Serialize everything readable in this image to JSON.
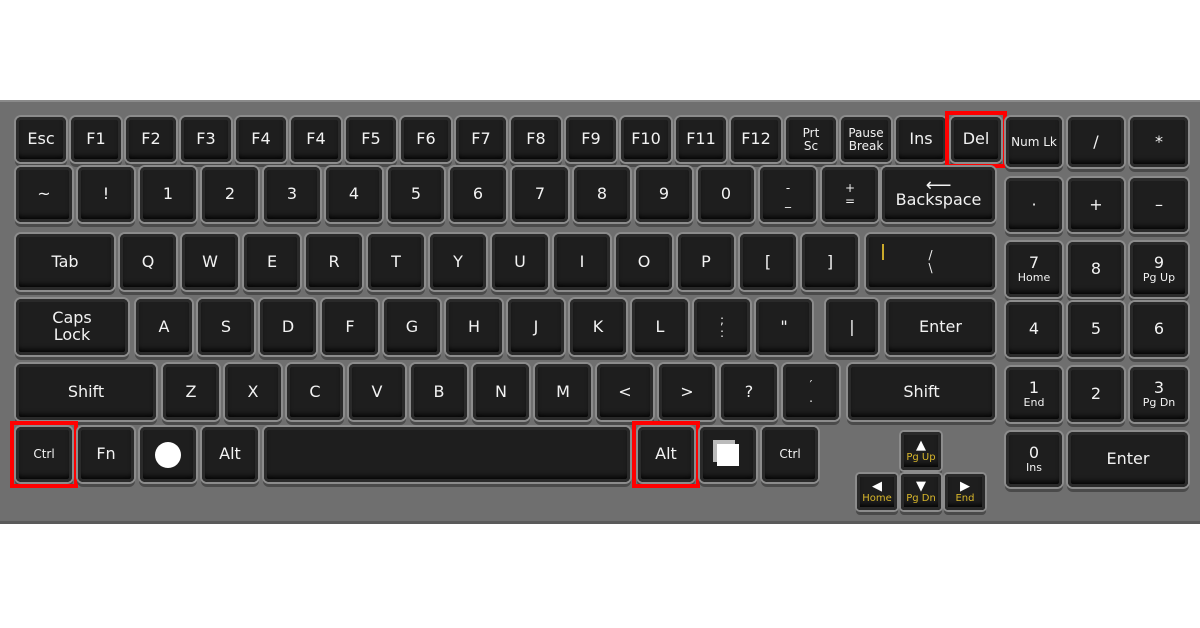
{
  "keyboard": {
    "rows": [
      [
        {
          "label": "Esc"
        },
        {
          "label": "F1"
        },
        {
          "label": "F2"
        },
        {
          "label": "F3"
        },
        {
          "label": "F4"
        },
        {
          "label": "F4"
        },
        {
          "label": "F5"
        },
        {
          "label": "F6"
        },
        {
          "label": "F7"
        },
        {
          "label": "F8"
        },
        {
          "label": "F9"
        },
        {
          "label": "F10"
        },
        {
          "label": "F11"
        },
        {
          "label": "F12"
        },
        {
          "label": "Prt\nSc"
        },
        {
          "label": "Pause\nBreak"
        },
        {
          "label": "Ins"
        },
        {
          "label": "Del",
          "highlighted": true
        },
        {
          "label": "Num Lk"
        },
        {
          "label": "/"
        },
        {
          "label": "*"
        }
      ],
      [
        {
          "label": "~"
        },
        {
          "label": "!"
        },
        {
          "label": "1"
        },
        {
          "label": "2"
        },
        {
          "label": "3"
        },
        {
          "label": "4"
        },
        {
          "label": "5"
        },
        {
          "label": "6"
        },
        {
          "label": "7"
        },
        {
          "label": "8"
        },
        {
          "label": "9"
        },
        {
          "label": "0"
        },
        {
          "label": "-\n_"
        },
        {
          "label": "+\n="
        },
        {
          "label": "Backspace",
          "icon": "left-arrow-icon"
        },
        {
          "label": "·"
        },
        {
          "label": "+"
        },
        {
          "label": "–"
        }
      ],
      [
        {
          "label": "Tab"
        },
        {
          "label": "Q"
        },
        {
          "label": "W"
        },
        {
          "label": "E"
        },
        {
          "label": "R"
        },
        {
          "label": "T"
        },
        {
          "label": "Y"
        },
        {
          "label": "U"
        },
        {
          "label": "I"
        },
        {
          "label": "O"
        },
        {
          "label": "P"
        },
        {
          "label": "["
        },
        {
          "label": "]"
        },
        {
          "label": "/\n\\",
          "accent": "|"
        },
        {
          "label": "7",
          "sub": "Home"
        },
        {
          "label": "8"
        },
        {
          "label": "9",
          "sub": "Pg Up"
        }
      ],
      [
        {
          "label": "Caps\nLock"
        },
        {
          "label": "A"
        },
        {
          "label": "S"
        },
        {
          "label": "D"
        },
        {
          "label": "F"
        },
        {
          "label": "G"
        },
        {
          "label": "H"
        },
        {
          "label": "J"
        },
        {
          "label": "K"
        },
        {
          "label": "L"
        },
        {
          "label": ";\n:"
        },
        {
          "label": "\""
        },
        {
          "label": "|"
        },
        {
          "label": "Enter"
        },
        {
          "label": "4"
        },
        {
          "label": "5"
        },
        {
          "label": "6"
        }
      ],
      [
        {
          "label": "Shift"
        },
        {
          "label": "Z"
        },
        {
          "label": "X"
        },
        {
          "label": "C"
        },
        {
          "label": "V"
        },
        {
          "label": "B"
        },
        {
          "label": "N"
        },
        {
          "label": "M"
        },
        {
          "label": "<"
        },
        {
          "label": ">"
        },
        {
          "label": "?"
        },
        {
          "label": "′\n."
        },
        {
          "label": "Shift"
        },
        {
          "label": "1",
          "sub": "End"
        },
        {
          "label": "2"
        },
        {
          "label": "3",
          "sub": "Pg Dn"
        }
      ],
      [
        {
          "label": "Ctrl",
          "highlighted": true
        },
        {
          "label": "Fn"
        },
        {
          "label": "",
          "icon": "windows-circle-icon"
        },
        {
          "label": "Alt"
        },
        {
          "label": ""
        },
        {
          "label": "Alt",
          "highlighted": true
        },
        {
          "label": "",
          "icon": "menu-icon"
        },
        {
          "label": "Ctrl"
        },
        {
          "label": "▲",
          "sub": "Pg Up"
        },
        {
          "label": "◀",
          "sub": "Home"
        },
        {
          "label": "▼",
          "sub": "Pg Dn"
        },
        {
          "label": "▶",
          "sub": "End"
        },
        {
          "label": "0",
          "sub": "Ins"
        },
        {
          "label": "Enter"
        }
      ]
    ],
    "highlight_color": "#ff0000",
    "accent_color": "#d8b62a"
  }
}
